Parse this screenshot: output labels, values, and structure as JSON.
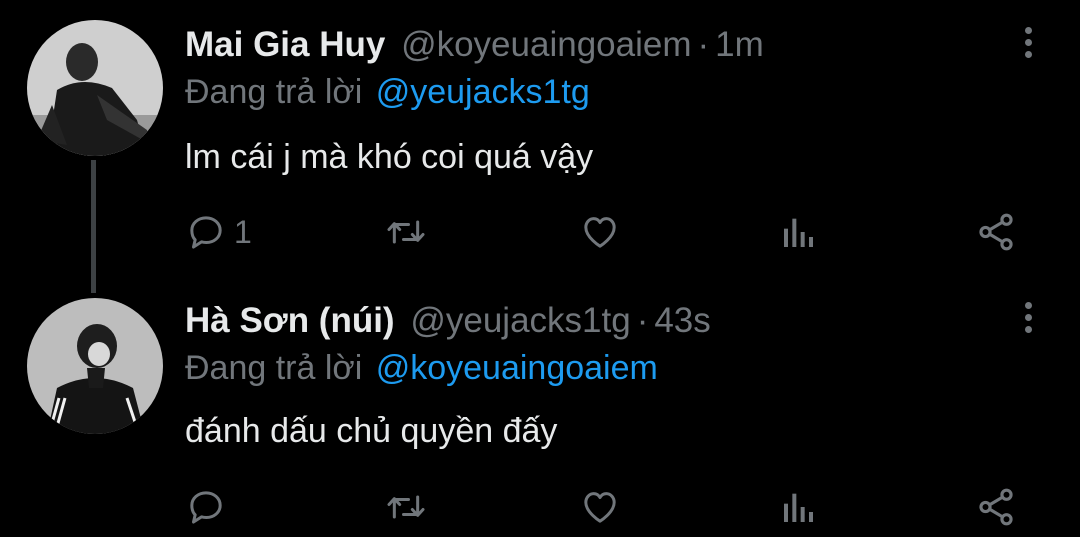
{
  "accent_color": "#1d9bf0",
  "text_color": "#e7e9ea",
  "muted_color": "#71767b",
  "background": "#000000",
  "tweets": [
    {
      "display_name": "Mai Gia Huy",
      "handle": "@koyeuaingoaiem",
      "separator": "·",
      "time": "1m",
      "reply_prefix": "Đang trả lời",
      "reply_to": "@yeujacks1tg",
      "text": "lm cái j mà khó coi quá vậy",
      "reply_count": "1",
      "icons": [
        "more-vertical-icon",
        "reply-icon",
        "retweet-icon",
        "like-icon",
        "views-icon",
        "share-icon"
      ]
    },
    {
      "display_name": "Hà Sơn (núi)",
      "handle": "@yeujacks1tg",
      "separator": "·",
      "time": "43s",
      "reply_prefix": "Đang trả lời",
      "reply_to": "@koyeuaingoaiem",
      "text": "đánh dấu chủ quyền đấy",
      "reply_count": "",
      "icons": [
        "more-vertical-icon",
        "reply-icon",
        "retweet-icon",
        "like-icon",
        "views-icon",
        "share-icon"
      ]
    }
  ]
}
